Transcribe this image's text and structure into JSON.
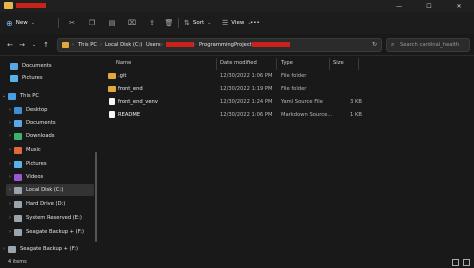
{
  "window": {
    "tab_title": "",
    "controls": {
      "minimize": "—",
      "maximize": "☐",
      "close": "✕"
    }
  },
  "toolbar": {
    "new_label": "New",
    "sort_label": "Sort",
    "view_label": "View",
    "more_label": "•••"
  },
  "address": {
    "crumbs": [
      "This PC",
      "Local Disk (C:)",
      "Users",
      "",
      "ProgrammingProjects",
      ""
    ],
    "search_placeholder": "Search cardinal_health"
  },
  "sidebar": {
    "items": [
      {
        "label": "Documents",
        "icon": "documents-icon",
        "color": "#5aa6e6",
        "chev": ""
      },
      {
        "label": "Pictures",
        "icon": "pictures-icon",
        "color": "#56b2e8",
        "chev": ""
      },
      {
        "label": "This PC",
        "icon": "this-pc-icon",
        "color": "#4a9ee0",
        "chev": "⌄"
      },
      {
        "label": "Desktop",
        "icon": "desktop-icon",
        "color": "#3f8fd6",
        "chev": "›"
      },
      {
        "label": "Documents",
        "icon": "documents-icon",
        "color": "#5aa6e6",
        "chev": "›"
      },
      {
        "label": "Downloads",
        "icon": "downloads-icon",
        "color": "#3bb36c",
        "chev": "›"
      },
      {
        "label": "Music",
        "icon": "music-icon",
        "color": "#e0683a",
        "chev": "›"
      },
      {
        "label": "Pictures",
        "icon": "pictures-icon",
        "color": "#56b2e8",
        "chev": "›"
      },
      {
        "label": "Videos",
        "icon": "videos-icon",
        "color": "#9b59d0",
        "chev": "›"
      },
      {
        "label": "Local Disk (C:)",
        "icon": "drive-icon",
        "color": "#9aa4ad",
        "chev": "›"
      },
      {
        "label": "Hard Drive (D:)",
        "icon": "drive-icon",
        "color": "#9aa4ad",
        "chev": "›"
      },
      {
        "label": "System Reserved (E:)",
        "icon": "drive-icon",
        "color": "#9aa4ad",
        "chev": "›"
      },
      {
        "label": "Seagate Backup + (F:)",
        "icon": "drive-icon",
        "color": "#9aa4ad",
        "chev": "›"
      },
      {
        "label": "Seagate Backup + (F:)",
        "icon": "drive-icon",
        "color": "#9aa4ad",
        "chev": "›"
      }
    ]
  },
  "table": {
    "columns": [
      "Name",
      "Date modified",
      "Type",
      "Size"
    ],
    "rows": [
      {
        "name": ".git",
        "date": "12/30/2022 1:06 PM",
        "type": "File folder",
        "size": "",
        "kind": "folder"
      },
      {
        "name": "front_end",
        "date": "12/30/2022 1:19 PM",
        "type": "File folder",
        "size": "",
        "kind": "folder"
      },
      {
        "name": "front_end_venv",
        "date": "12/30/2022 1:24 PM",
        "type": "Yaml Source File",
        "size": "3 KB",
        "kind": "file"
      },
      {
        "name": "README",
        "date": "12/30/2022 1:06 PM",
        "type": "Markdown Source...",
        "size": "1 KB",
        "kind": "file"
      }
    ]
  },
  "status": {
    "item_count": "4 items"
  },
  "colors": {
    "accent": "#4a9ee0",
    "redaction": "#c8221a",
    "folder": "#e0a93a"
  }
}
